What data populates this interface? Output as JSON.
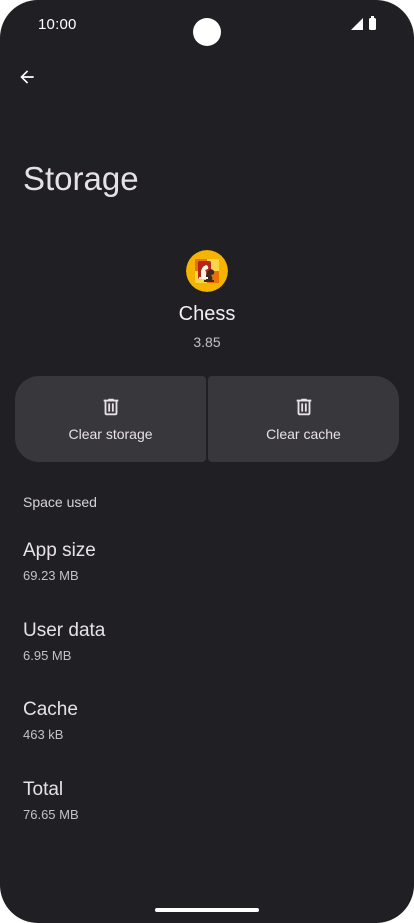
{
  "status_bar": {
    "time": "10:00"
  },
  "header": {
    "title": "Storage"
  },
  "app": {
    "name": "Chess",
    "version": "3.85",
    "icon": "chess-app-icon"
  },
  "actions": {
    "clear_storage_label": "Clear storage",
    "clear_cache_label": "Clear cache"
  },
  "space_used": {
    "header": "Space used",
    "items": [
      {
        "title": "App size",
        "value": "69.23 MB"
      },
      {
        "title": "User data",
        "value": "6.95 MB"
      },
      {
        "title": "Cache",
        "value": "463 kB"
      },
      {
        "title": "Total",
        "value": "76.65 MB"
      }
    ]
  },
  "colors": {
    "background": "#202024",
    "button_background": "#38373c",
    "text_primary": "#e6e1e5",
    "text_secondary": "#c4c0c8"
  }
}
